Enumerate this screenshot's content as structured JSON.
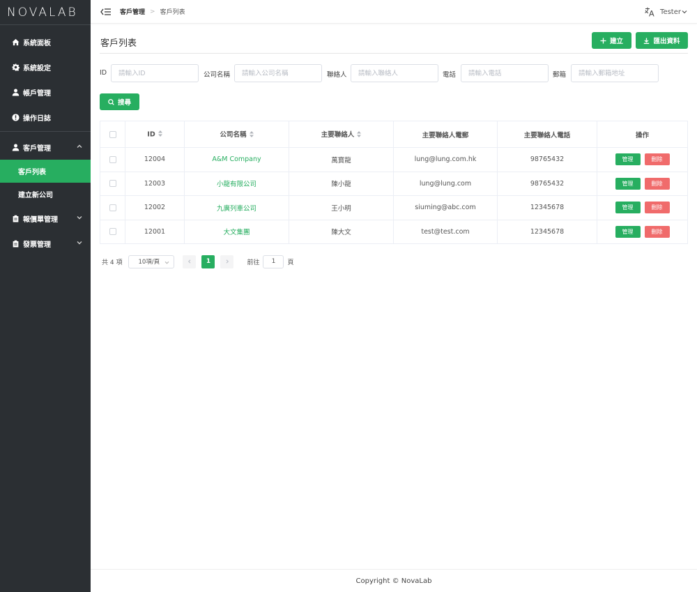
{
  "logo": "NOVALAB",
  "sidebar": {
    "items": [
      {
        "label": "系統面板",
        "icon": "home-icon"
      },
      {
        "label": "系統設定",
        "icon": "gear-icon"
      },
      {
        "label": "帳戶管理",
        "icon": "user-icon"
      },
      {
        "label": "操作日誌",
        "icon": "alert-circle-icon"
      }
    ],
    "customer": {
      "label": "客戶管理",
      "icon": "user-icon",
      "expanded": true
    },
    "customer_sub": [
      {
        "label": "客戶列表",
        "active": true
      },
      {
        "label": "建立新公司",
        "active": false
      }
    ],
    "quotation": {
      "label": "報價單管理",
      "icon": "clipboard-icon"
    },
    "invoice": {
      "label": "發票管理",
      "icon": "clipboard-icon"
    }
  },
  "header": {
    "breadcrumb_parent": "客戶管理",
    "breadcrumb_sep": ">",
    "breadcrumb_current": "客戶列表",
    "user": "Tester"
  },
  "main": {
    "title": "客戶列表",
    "create_label": "建立",
    "export_label": "匯出資料",
    "search_label": "搜尋"
  },
  "filters": {
    "id": {
      "label": "ID",
      "placeholder": "請輸入ID"
    },
    "company": {
      "label": "公司名稱",
      "placeholder": "請輸入公司名稱"
    },
    "contact": {
      "label": "聯絡人",
      "placeholder": "請輸入聯絡人"
    },
    "phone": {
      "label": "電話",
      "placeholder": "請輸入電話"
    },
    "email": {
      "label": "郵箱",
      "placeholder": "請輸入郵箱地址"
    }
  },
  "table": {
    "headers": {
      "id": "ID",
      "company": "公司名稱",
      "contact": "主要聯絡人",
      "email": "主要聯絡人電郵",
      "phone": "主要聯絡人電話",
      "actions": "操作"
    },
    "manage_label": "管理",
    "delete_label": "刪除",
    "rows": [
      {
        "id": "12004",
        "company": "A&M Company",
        "contact": "萬寶龍",
        "email": "lung@lung.com.hk",
        "phone": "98765432"
      },
      {
        "id": "12003",
        "company": "小龍有限公司",
        "contact": "陳小龍",
        "email": "lung@lung.com",
        "phone": "98765432"
      },
      {
        "id": "12002",
        "company": "九廣列車公司",
        "contact": "王小明",
        "email": "siuming@abc.com",
        "phone": "12345678"
      },
      {
        "id": "12001",
        "company": "大文集團",
        "contact": "陳大文",
        "email": "test@test.com",
        "phone": "12345678"
      }
    ]
  },
  "pagination": {
    "total": "共 4 項",
    "page_size": "10項/頁",
    "current_page": "1",
    "goto_prefix": "前往",
    "goto_value": "1",
    "goto_suffix": "頁"
  },
  "footer": "Copyright © NovaLab",
  "colors": {
    "accent": "#27ae60",
    "danger": "#f06b6b",
    "sidebar_bg": "#2b2f33"
  }
}
